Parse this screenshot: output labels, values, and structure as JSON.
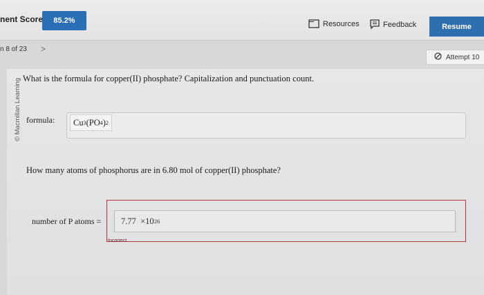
{
  "header": {
    "score_label": "nent Score:",
    "score_value": "85.2%",
    "resources_label": "Resources",
    "feedback_label": "Feedback",
    "resume_label": "Resume"
  },
  "nav": {
    "position": "n 8 of 23",
    "next": ">"
  },
  "attempt": {
    "label": "Attempt 10"
  },
  "brand": {
    "text": "© Macmillan Learning"
  },
  "question1": {
    "prompt": "What is the formula for copper(II) phosphate? Capitalization and punctuation count.",
    "label": "formula:",
    "answer_parts": {
      "cu": "Cu",
      "sub3": "3",
      "po": "(PO",
      "sub4": "4",
      "close": ")",
      "sub2": "2"
    }
  },
  "question2": {
    "prompt": "How many atoms of phosphorus are in 6.80 mol of copper(II) phosphate?",
    "label": "number of P atoms =",
    "answer_mantissa": "7.77",
    "answer_times": "×10",
    "answer_exponent": "26",
    "status": "Incorrect"
  },
  "colors": {
    "accent": "#2a6fb5",
    "error": "#b8343a"
  },
  "icons": {
    "resources": "document-icon",
    "feedback": "feedback-icon",
    "attempt": "no-entry-icon"
  }
}
